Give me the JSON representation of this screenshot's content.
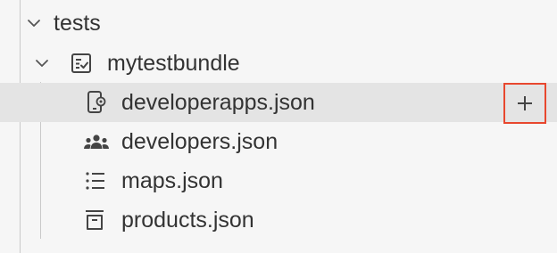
{
  "explorer": {
    "root": {
      "label": "tests",
      "expanded": true,
      "icon": "chevron-down-icon"
    },
    "bundle": {
      "label": "mytestbundle",
      "expanded": true,
      "chevron_icon": "chevron-down-icon",
      "icon": "test-bundle-icon"
    },
    "files": [
      {
        "label": "developerapps.json",
        "icon": "mobile-app-gear-icon",
        "selected": true
      },
      {
        "label": "developers.json",
        "icon": "people-icon",
        "selected": false
      },
      {
        "label": "maps.json",
        "icon": "list-icon",
        "selected": false
      },
      {
        "label": "products.json",
        "icon": "package-icon",
        "selected": false
      }
    ],
    "hover_action": {
      "label": "+",
      "icon": "plus-icon",
      "highlight_color": "#e8472e"
    }
  },
  "colors": {
    "background": "#f6f6f6",
    "selected_row": "#e4e4e4",
    "text": "#333333",
    "guide": "#c9c9c9"
  }
}
